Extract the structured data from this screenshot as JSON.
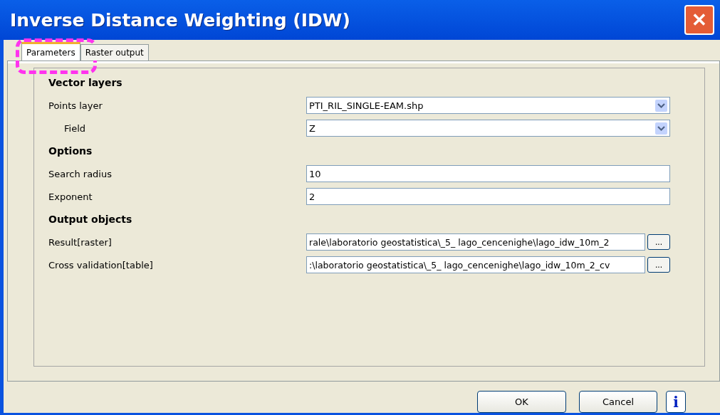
{
  "window": {
    "title": "Inverse Distance Weighting (IDW)",
    "close": "✕"
  },
  "tabs": [
    {
      "label": "Parameters",
      "selected": true
    },
    {
      "label": "Raster output",
      "selected": false
    }
  ],
  "sections": [
    {
      "title": "Vector layers",
      "rows": [
        {
          "label": "Points layer",
          "kind": "combo",
          "value": "PTI_RIL_SINGLE-EAM.shp",
          "children": [
            {
              "label": "Field",
              "kind": "combo",
              "value": "Z"
            }
          ]
        }
      ]
    },
    {
      "title": "Options",
      "rows": [
        {
          "label": "Search radius",
          "kind": "text",
          "value": "10"
        },
        {
          "label": "Exponent",
          "kind": "text",
          "value": "2"
        }
      ]
    },
    {
      "title": "Output objects",
      "rows": [
        {
          "label": "Result[raster]",
          "kind": "file",
          "value": "rale\\laboratorio geostatistica\\_5_ lago_cencenighe\\lago_idw_10m_2",
          "browse": "..."
        },
        {
          "label": "Cross validation[table]",
          "kind": "file",
          "value": ":\\laboratorio geostatistica\\_5_ lago_cencenighe\\lago_idw_10m_2_cv",
          "browse": "..."
        }
      ]
    }
  ],
  "buttons": [
    {
      "label": "OK",
      "kind": "text"
    },
    {
      "label": "Cancel",
      "kind": "text"
    },
    {
      "label": "i",
      "kind": "info"
    }
  ]
}
